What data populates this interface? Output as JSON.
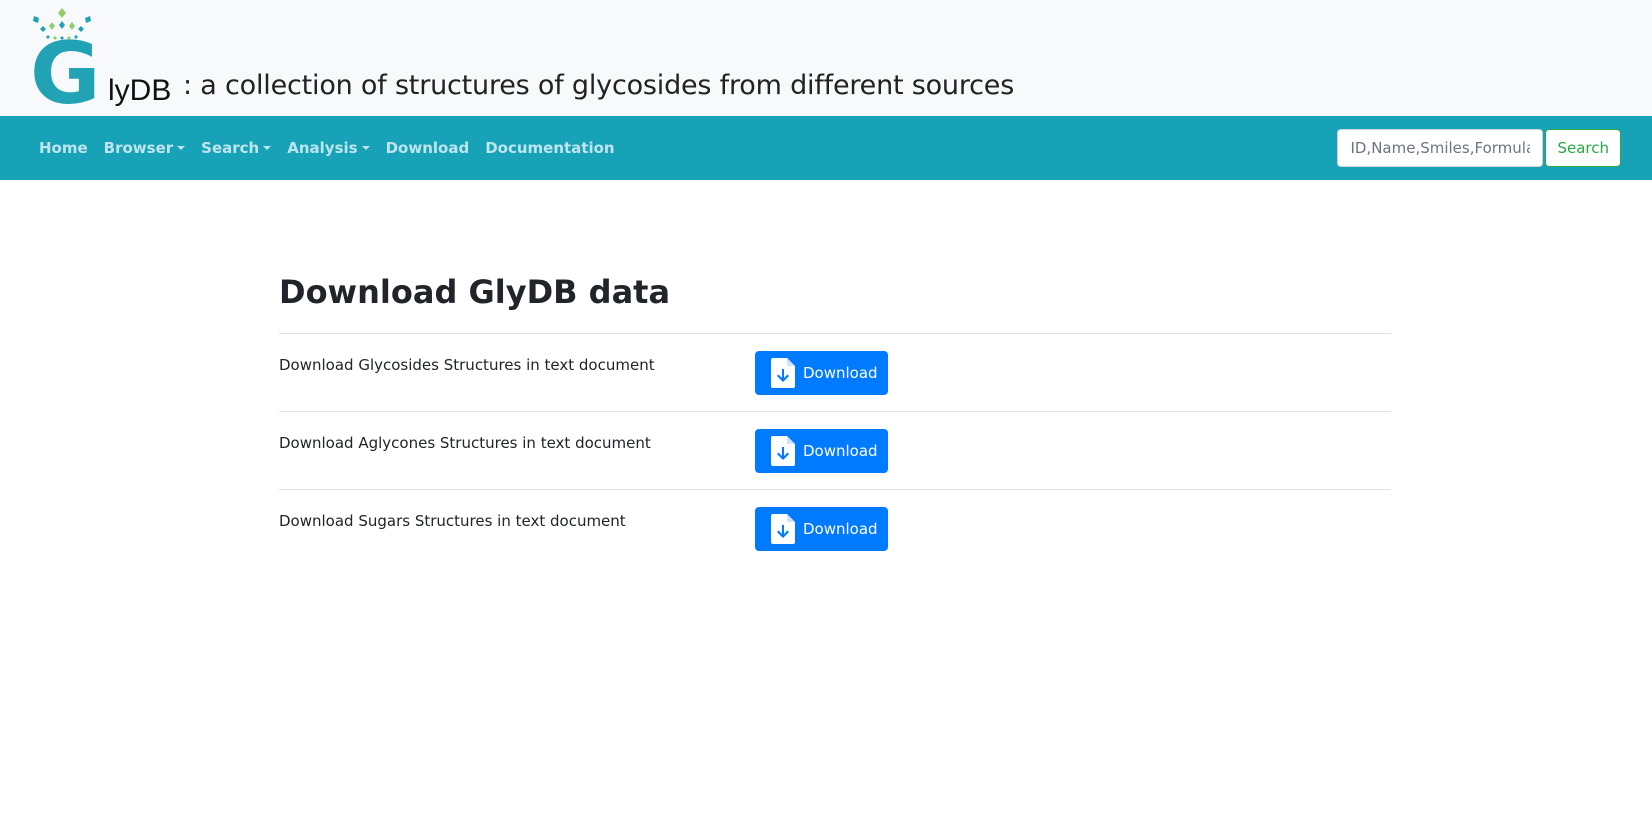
{
  "header": {
    "logo_letter": "G",
    "logo_rest": "lyDB",
    "tagline": ": a collection of structures of glycosides from different sources"
  },
  "nav": {
    "items": [
      {
        "label": "Home",
        "dropdown": false
      },
      {
        "label": "Browser",
        "dropdown": true
      },
      {
        "label": "Search",
        "dropdown": true
      },
      {
        "label": "Analysis",
        "dropdown": true
      },
      {
        "label": "Download",
        "dropdown": false
      },
      {
        "label": "Documentation",
        "dropdown": false
      }
    ],
    "search_placeholder": "ID,Name,Smiles,Formula",
    "search_button": "Search"
  },
  "main": {
    "title": "Download GlyDB data",
    "rows": [
      {
        "label": "Download Glycosides Structures in text document",
        "button": "Download"
      },
      {
        "label": "Download Aglycones Structures in text document",
        "button": "Download"
      },
      {
        "label": "Download Sugars Structures in text document",
        "button": "Download"
      }
    ]
  },
  "colors": {
    "navbar": "#17a2b8",
    "header_bg": "#f8f9fa",
    "logo_teal": "#22a2b5",
    "logo_green": "#8fce6a",
    "download_button": "#007bff",
    "search_button": "#28a745"
  }
}
